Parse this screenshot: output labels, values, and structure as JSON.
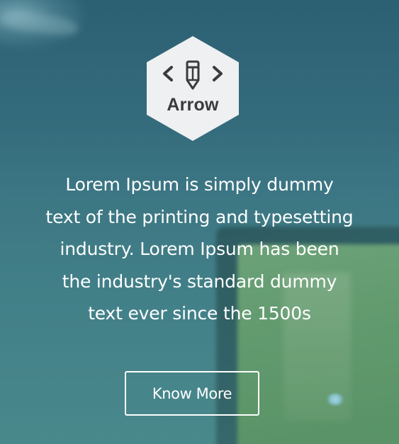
{
  "logo": {
    "icon": "code-pencil-icon",
    "text": "Arrow"
  },
  "hero": {
    "lines": [
      "Lorem Ipsum is simply dummy",
      "text of the printing and typesetting",
      "industry. Lorem Ipsum has been",
      "the industry's standard dummy",
      "text ever since the 1500s"
    ],
    "cta_label": "Know More"
  },
  "colors": {
    "text": "#ffffff",
    "logo_bg": "#eef0f1",
    "logo_ink": "#3b3b3b"
  }
}
